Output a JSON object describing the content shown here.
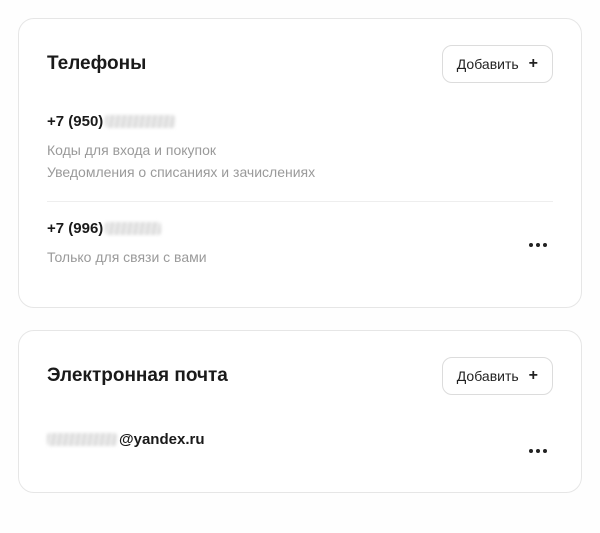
{
  "phones": {
    "title": "Телефоны",
    "add_label": "Добавить",
    "items": [
      {
        "prefix": "+7 (950)",
        "desc_line1": "Коды для входа и покупок",
        "desc_line2": "Уведомления о списаниях и зачислениях",
        "has_more": false
      },
      {
        "prefix": "+7 (996)",
        "desc_line1": "Только для связи с вами",
        "has_more": true
      }
    ]
  },
  "email": {
    "title": "Электронная почта",
    "add_label": "Добавить",
    "items": [
      {
        "domain": "@yandex.ru",
        "has_more": true
      }
    ]
  }
}
